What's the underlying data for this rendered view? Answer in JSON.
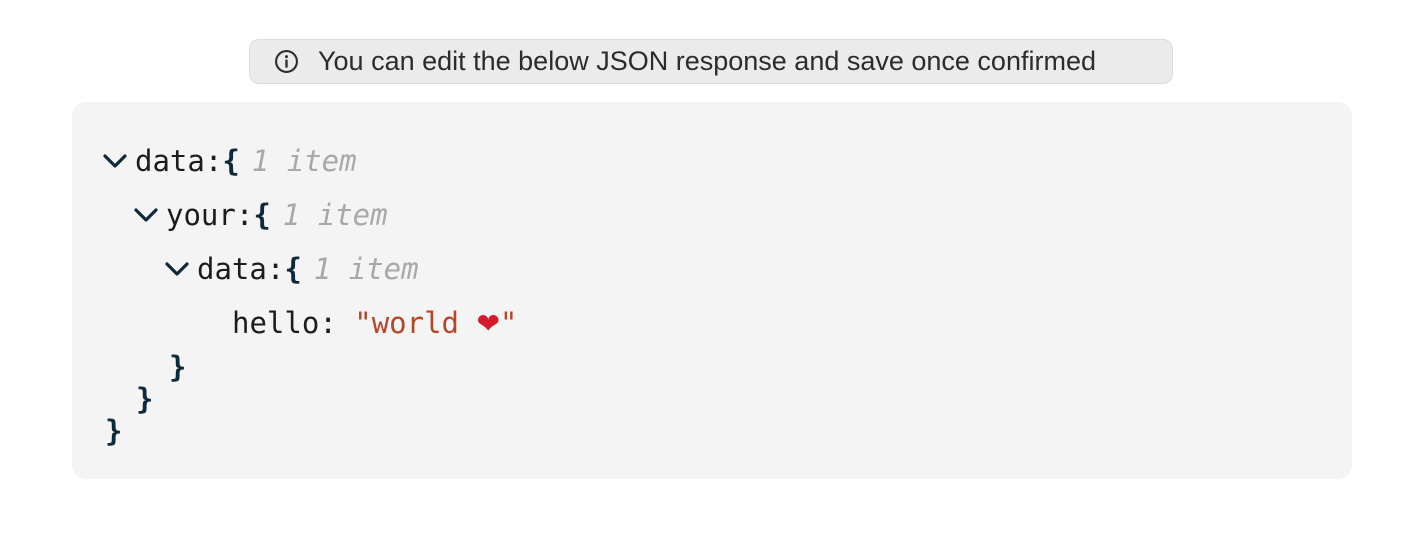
{
  "notice": {
    "icon": "info-icon",
    "text": "You can edit the below JSON response and save once confirmed"
  },
  "colors": {
    "panel_bg": "#f4f4f4",
    "string_value": "#b6462a",
    "brace": "#0e2a3a",
    "item_count": "#a8a8a8"
  },
  "tree": {
    "root": {
      "key": "data",
      "colon": ":",
      "open": "{",
      "count": "1 item",
      "close": "}",
      "expanded": true
    },
    "child": {
      "key": "your",
      "colon": ":",
      "open": "{",
      "count": "1 item",
      "close": "}",
      "expanded": true
    },
    "grandchild": {
      "key": "data",
      "colon": ":",
      "open": "{",
      "count": "1 item",
      "close": "}",
      "expanded": true
    },
    "leaf": {
      "key": "hello",
      "colon": ": ",
      "value_prefix": "\"world ",
      "value_emoji": "❤",
      "value_suffix": "\""
    }
  }
}
